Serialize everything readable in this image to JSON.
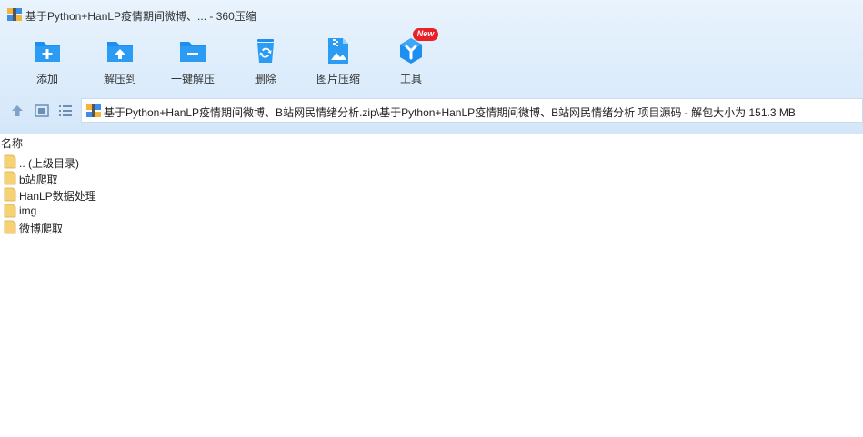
{
  "window": {
    "title": "基于Python+HanLP疫情期间微博、... - 360压缩"
  },
  "toolbar": {
    "items": [
      {
        "label": "添加",
        "icon": "add-folder-icon"
      },
      {
        "label": "解压到",
        "icon": "extract-to-icon"
      },
      {
        "label": "一键解压",
        "icon": "one-click-extract-icon"
      },
      {
        "label": "删除",
        "icon": "recycle-bin-icon"
      },
      {
        "label": "图片压缩",
        "icon": "image-compress-icon"
      },
      {
        "label": "工具",
        "icon": "tools-icon",
        "badge": "New"
      }
    ]
  },
  "navbar": {
    "address": "基于Python+HanLP疫情期间微博、B站网民情绪分析.zip\\基于Python+HanLP疫情期间微博、B站网民情绪分析 项目源码 - 解包大小为 151.3 MB"
  },
  "filelist": {
    "header": "名称",
    "rows": [
      {
        "name": ".. (上级目录)"
      },
      {
        "name": "b站爬取"
      },
      {
        "name": "HanLP数据处理"
      },
      {
        "name": "img"
      },
      {
        "name": "微博爬取"
      }
    ]
  },
  "colors": {
    "accent": "#1e8ef0",
    "badge": "#e8202a",
    "toolbar_bg": "#dcecfb",
    "folder": "#f6d274"
  }
}
